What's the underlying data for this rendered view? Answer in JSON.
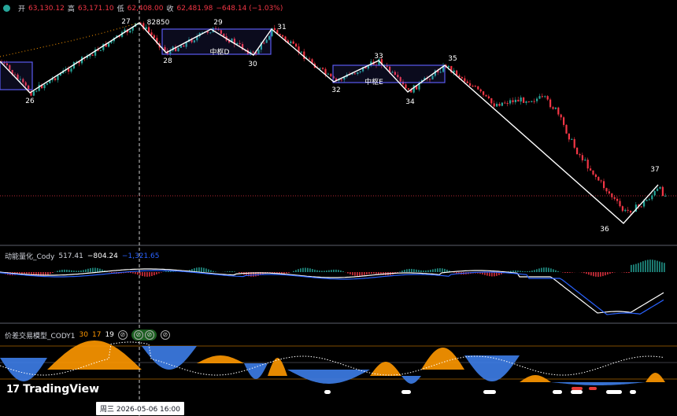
{
  "ohlc": {
    "open_label": "开",
    "open": "63,130.12",
    "high_label": "高",
    "high": "63,171.10",
    "low_label": "低",
    "low": "62,408.00",
    "close_label": "收",
    "close": "62,481.98",
    "change": "−648.14 (−1.03%)"
  },
  "indicator1": {
    "name": "动能量化_Cody",
    "value1": "517.41",
    "value2": "−804.24",
    "value3": "−1,321.65"
  },
  "indicator2": {
    "name": "价差交易模型_CODY1",
    "value1": "30",
    "value2": "17",
    "value3": "19",
    "toggle_symbol": "⊘"
  },
  "price_labels": {
    "high_price": "82850"
  },
  "pivot_labels": [
    "26",
    "27",
    "28",
    "29",
    "30",
    "31",
    "32",
    "33",
    "34",
    "35",
    "36",
    "37"
  ],
  "zones": {
    "zone_d": "中枢D",
    "zone_e": "中枢E"
  },
  "crosshair": {
    "date_label": "周三 2026-05-06   16:00"
  },
  "branding": {
    "logo_text": "TradingView"
  },
  "colors": {
    "up": "#26a69a",
    "down": "#f23645",
    "accent_blue": "#2962ff",
    "orange": "#ff9800",
    "zone_border": "#5b5bf0"
  }
}
